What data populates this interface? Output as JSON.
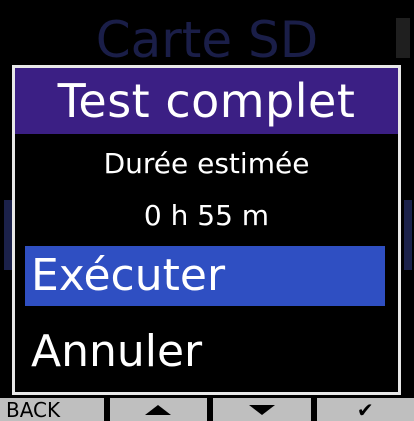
{
  "background": {
    "title": "Carte SD"
  },
  "dialog": {
    "title": "Test complet",
    "info_label": "Durée estimée",
    "info_value": "0 h 55 m",
    "options": [
      {
        "label": "Exécuter",
        "selected": true
      },
      {
        "label": "Annuler",
        "selected": false
      }
    ]
  },
  "softkeys": {
    "back_label": "BACK",
    "up_icon": "triangle-up-icon",
    "down_icon": "triangle-down-icon",
    "confirm_icon": "check-icon",
    "confirm_glyph": "✔"
  },
  "colors": {
    "header_bg": "#3b1f84",
    "selected_bg": "#2f4fc2",
    "softkey_bg": "#bfbfbf"
  }
}
